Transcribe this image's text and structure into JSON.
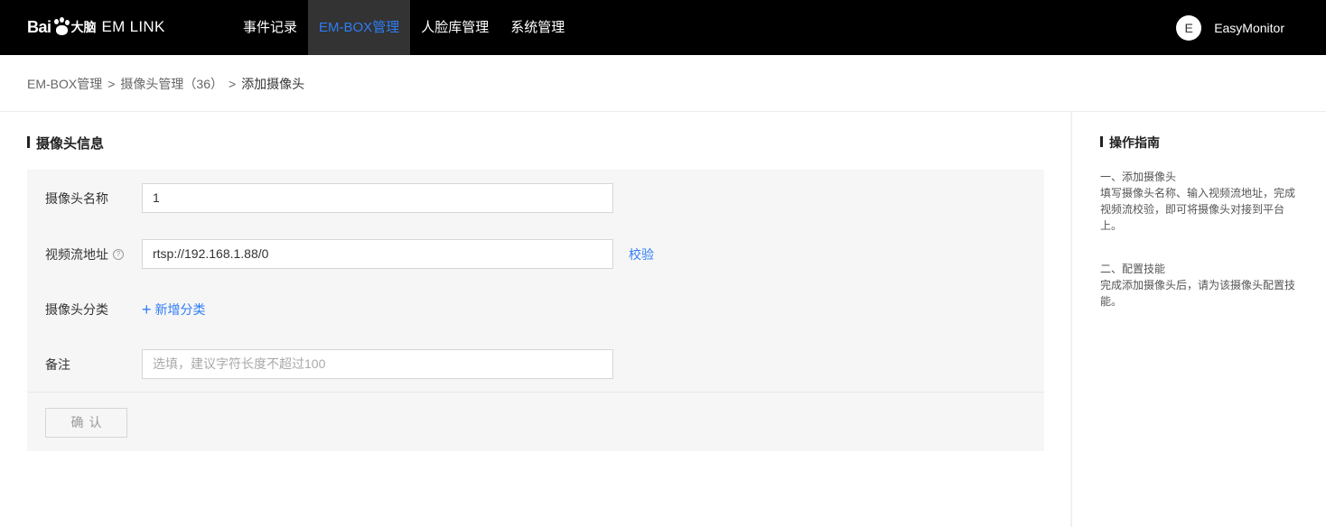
{
  "header": {
    "brand_baidu": "Bai",
    "brand_dunao": "大脑",
    "brand_product": "EM LINK",
    "nav": [
      {
        "label": "事件记录",
        "active": false
      },
      {
        "label": "EM-BOX管理",
        "active": true
      },
      {
        "label": "人脸库管理",
        "active": false
      },
      {
        "label": "系统管理",
        "active": false
      }
    ],
    "avatar_initial": "E",
    "username": "EasyMonitor"
  },
  "breadcrumb": {
    "items": [
      "EM-BOX管理",
      "摄像头管理（36）",
      "添加摄像头"
    ],
    "separator": ">"
  },
  "form": {
    "section_title": "摄像头信息",
    "name_label": "摄像头名称",
    "name_value": "1",
    "stream_label": "视频流地址",
    "stream_help_icon": "question-circle-icon",
    "stream_value": "rtsp://192.168.1.88/0",
    "verify_label": "校验",
    "category_label": "摄像头分类",
    "add_category_plus": "+",
    "add_category_label": "新增分类",
    "remark_label": "备注",
    "remark_placeholder": "选填，建议字符长度不超过100",
    "confirm_label": "确认"
  },
  "guide": {
    "title": "操作指南",
    "step1_title": "一、添加摄像头",
    "step1_text": "填写摄像头名称、输入视频流地址，完成视频流校验，即可将摄像头对接到平台上。",
    "step2_title": "二、配置技能",
    "step2_text": "完成添加摄像头后，请为该摄像头配置技能。"
  },
  "colors": {
    "topbar_bg": "#000000",
    "accent": "#2f7df6",
    "active_nav_bg": "#333333"
  }
}
